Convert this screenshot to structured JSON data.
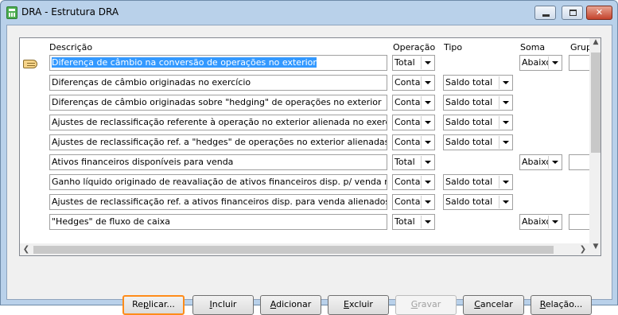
{
  "window": {
    "title": "DRA - Estrutura DRA"
  },
  "grid": {
    "headers": {
      "descricao": "Descrição",
      "operacao": "Operação",
      "tipo": "Tipo",
      "soma": "Soma",
      "grupo": "Grup"
    },
    "rows": [
      {
        "descricao": "Diferença de câmbio na conversão de operações no exterior",
        "operacao": "Total",
        "tipo": "",
        "soma": "Abaixo",
        "selected": true
      },
      {
        "descricao": "Diferenças de câmbio originadas no exercício",
        "operacao": "Contas",
        "tipo": "Saldo total",
        "soma": ""
      },
      {
        "descricao": "Diferenças de câmbio originadas sobre \"hedging\" de operações no exterior",
        "operacao": "Contas",
        "tipo": "Saldo total",
        "soma": ""
      },
      {
        "descricao": "Ajustes de reclassificação referente à operação no exterior alienada no exercício",
        "operacao": "Contas",
        "tipo": "Saldo total",
        "soma": ""
      },
      {
        "descricao": "Ajustes de reclassificação ref. a \"hedges\" de operações no exterior alienadas no exercíci",
        "operacao": "Contas",
        "tipo": "Saldo total",
        "soma": ""
      },
      {
        "descricao": "Ativos financeiros disponíveis para venda",
        "operacao": "Total",
        "tipo": "",
        "soma": "Abaixo"
      },
      {
        "descricao": "Ganho líquido originado de reavaliação de ativos financeiros disp. p/ venda no exercício",
        "operacao": "Contas",
        "tipo": "Saldo total",
        "soma": ""
      },
      {
        "descricao": "Ajustes de reclassificação ref. a ativos financeiros disp. para venda alienados no exercíci",
        "operacao": "Contas",
        "tipo": "Saldo total",
        "soma": ""
      },
      {
        "descricao": "\"Hedges\" de fluxo de caixa",
        "operacao": "Total",
        "tipo": "",
        "soma": "Abaixo"
      }
    ]
  },
  "buttons": {
    "replicar": {
      "pre": "Re",
      "u": "p",
      "post": "licar..."
    },
    "incluir": {
      "pre": "",
      "u": "I",
      "post": "ncluir"
    },
    "adicionar": {
      "pre": "",
      "u": "A",
      "post": "dicionar"
    },
    "excluir": {
      "pre": "",
      "u": "E",
      "post": "xcluir"
    },
    "gravar": {
      "pre": "",
      "u": "G",
      "post": "ravar"
    },
    "cancelar": {
      "pre": "",
      "u": "C",
      "post": "ancelar"
    },
    "relacao": {
      "pre": "",
      "u": "R",
      "post": "elação..."
    }
  }
}
